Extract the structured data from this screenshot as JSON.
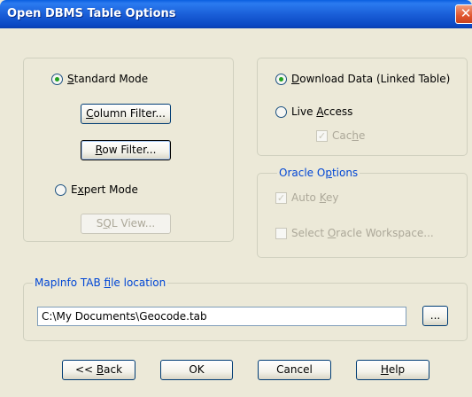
{
  "window": {
    "title": "Open DBMS Table Options",
    "close_symbol": "✕"
  },
  "mode": {
    "standard": {
      "label_pre": "",
      "label_u": "S",
      "label_post": "tandard Mode",
      "selected": true
    },
    "column_filter": {
      "label_pre": "",
      "label_u": "C",
      "label_post": "olumn Filter..."
    },
    "row_filter": {
      "label_pre": "",
      "label_u": "R",
      "label_post": "ow Filter..."
    },
    "expert": {
      "label_pre": "E",
      "label_u": "x",
      "label_post": "pert Mode",
      "selected": false
    },
    "sql_view": {
      "label_pre": "S",
      "label_u": "Q",
      "label_post": "L View..."
    }
  },
  "access": {
    "download": {
      "label_pre": "",
      "label_u": "D",
      "label_post": "ownload Data (Linked Table)",
      "selected": true
    },
    "live": {
      "label_pre": "Live ",
      "label_u": "A",
      "label_post": "ccess",
      "selected": false
    },
    "cache": {
      "label_pre": "Cac",
      "label_u": "h",
      "label_post": "e",
      "checked": true
    }
  },
  "oracle": {
    "title_pre": "Oracle O",
    "title_u": "p",
    "title_post": "tions",
    "auto_key": {
      "label_pre": "Auto ",
      "label_u": "K",
      "label_post": "ey",
      "checked": true
    },
    "workspace": {
      "label_pre": "Select ",
      "label_u": "O",
      "label_post": "racle Workspace...",
      "checked": false
    }
  },
  "tabfile": {
    "title_pre": "MapInfo TAB ",
    "title_u": "f",
    "title_post": "ile location",
    "path": "C:\\My Documents\\Geocode.tab",
    "browse_label": "..."
  },
  "buttons": {
    "back": {
      "pre": "<< ",
      "u": "B",
      "post": "ack"
    },
    "ok": {
      "label": "OK"
    },
    "cancel": {
      "label": "Cancel"
    },
    "help": {
      "pre": "",
      "u": "H",
      "post": "elp"
    }
  },
  "check_mark": "✓"
}
